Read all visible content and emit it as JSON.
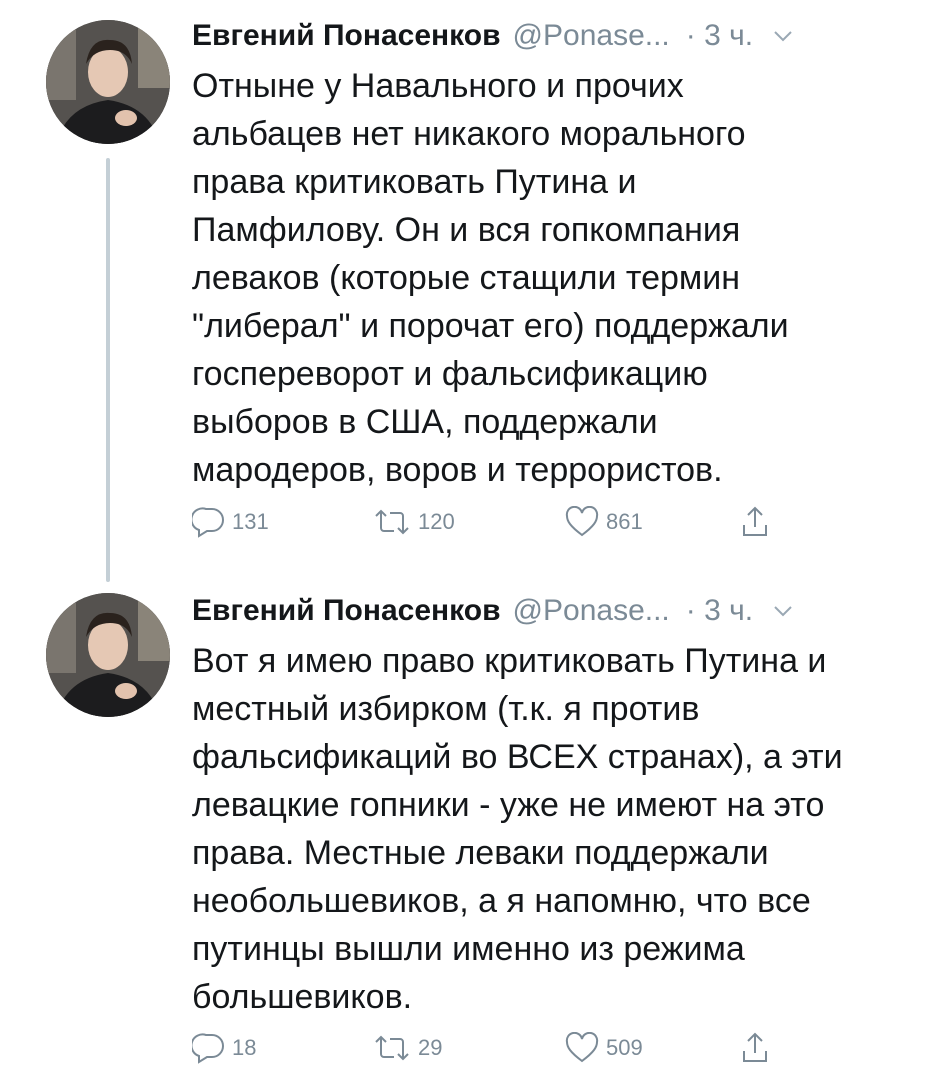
{
  "tweets": [
    {
      "author_name": "Евгений Понасенков",
      "handle": "@Ponase...",
      "time": "· 3 ч.",
      "text_lines": [
        "Отныне у Навального и прочих",
        "альбацев нет никакого морального",
        "права критиковать Путина и",
        "Памфилову. Он и вся гопкомпания",
        "леваков (которые стащили термин",
        "\"либерал\" и порочат его) поддержали",
        "госпереворот и фальсификацию",
        "выборов в США, поддержали",
        "мародеров, воров и террористов."
      ],
      "replies": "131",
      "retweets": "120",
      "likes": "861"
    },
    {
      "author_name": "Евгений Понасенков",
      "handle": "@Ponase...",
      "time": "· 3 ч.",
      "text_lines": [
        "Вот я имею право критиковать Путина и",
        "местный избирком (т.к. я против",
        "фальсификаций во ВСЕХ странах), а эти",
        "левацкие гопники - уже не имеют на это",
        "права. Местные леваки поддержали",
        "необольшевиков, а я напомню, что все",
        "путинцы вышли именно из режима",
        "большевиков."
      ],
      "replies": "18",
      "retweets": "29",
      "likes": "509"
    }
  ],
  "icons": {
    "reply": "reply-icon",
    "retweet": "retweet-icon",
    "like": "heart-icon",
    "share": "share-icon",
    "menu": "chevron-down-icon"
  },
  "colors": {
    "text": "#14171a",
    "secondary": "#7b8a96",
    "thread_line": "#c4cfd6"
  }
}
